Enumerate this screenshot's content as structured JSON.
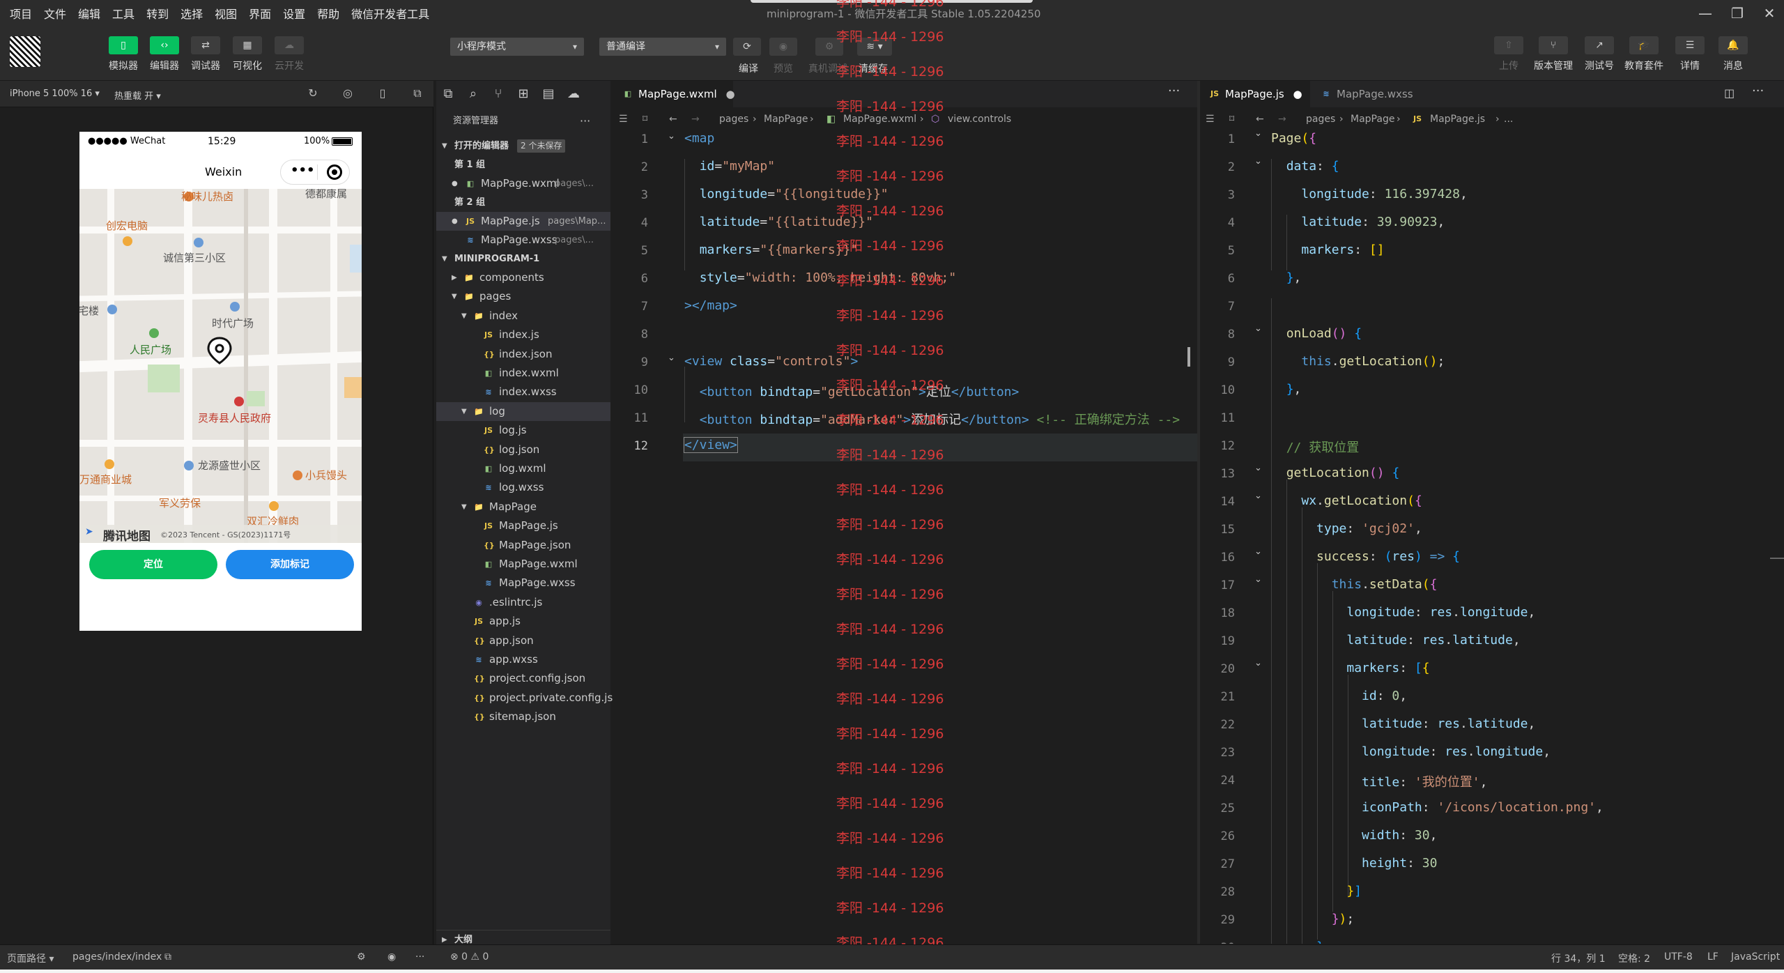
{
  "menu": [
    "项目",
    "文件",
    "编辑",
    "工具",
    "转到",
    "选择",
    "视图",
    "界面",
    "设置",
    "帮助",
    "微信开发者工具"
  ],
  "window_title": "miniprogram-1 - 微信开发者工具 Stable 1.05.2204250",
  "toolbar": {
    "left_buttons": [
      {
        "label": "模拟器",
        "icon": "phone-icon",
        "on": true
      },
      {
        "label": "编辑器",
        "icon": "code-icon",
        "on": true
      },
      {
        "label": "调试器",
        "icon": "debug-icon",
        "on": false
      },
      {
        "label": "可视化",
        "icon": "layout-icon",
        "on": false
      },
      {
        "label": "云开发",
        "icon": "cloud-icon",
        "on": false
      }
    ],
    "mode_select": "小程序模式",
    "compile_select": "普通编译",
    "mid_labels": [
      "编译",
      "预览",
      "真机调试",
      "清缓存"
    ],
    "right_buttons": [
      {
        "label": "上传",
        "icon": "upload-icon"
      },
      {
        "label": "版本管理",
        "icon": "branch-icon"
      },
      {
        "label": "测试号",
        "icon": "external-icon"
      },
      {
        "label": "教育套件",
        "icon": "graduation-icon"
      },
      {
        "label": "详情",
        "icon": "list-icon"
      },
      {
        "label": "消息",
        "icon": "bell-icon"
      }
    ]
  },
  "simulator": {
    "device": "iPhone 5 100% 16 ▾",
    "hot_reload": "热重载 开 ▾",
    "status_left": "●●●●● WeChat",
    "status_time": "15:29",
    "status_right": "100%",
    "nav_title": "Weixin",
    "map_pois": [
      "秘味儿热卤",
      "德都康属",
      "创宏电脑",
      "诚信第三小区",
      "时代广场",
      "宅楼",
      "人民广场",
      "灵寿县人民政府",
      "万通商业城",
      "龙源盛世小区",
      "小兵馒头",
      "军义劳保",
      "双汇冷鲜肉",
      "腾讯地图",
      "©2023 Tencent - GS(2023)1171号"
    ],
    "button_locate": "定位",
    "button_add_marker": "添加标记"
  },
  "explorer": {
    "title": "资源管理器",
    "open_editors": "打开的编辑器",
    "unsaved_badge": "2 个未保存",
    "group1": "第 1 组",
    "group1_file": "MapPage.wxml",
    "group1_file_path": "pages\\...",
    "group2": "第 2 组",
    "group2_file1": "MapPage.js",
    "group2_file1_path": "pages\\Map...",
    "group2_file2": "MapPage.wxss",
    "group2_file2_path": "pages\\...",
    "project": "MINIPROGRAM-1",
    "tree": [
      {
        "name": "components",
        "type": "folder",
        "depth": 1,
        "open": false
      },
      {
        "name": "pages",
        "type": "folder",
        "depth": 1,
        "open": true
      },
      {
        "name": "index",
        "type": "folder",
        "depth": 2,
        "open": true
      },
      {
        "name": "index.js",
        "type": "js",
        "depth": 3
      },
      {
        "name": "index.json",
        "type": "json",
        "depth": 3
      },
      {
        "name": "index.wxml",
        "type": "wxml",
        "depth": 3
      },
      {
        "name": "index.wxss",
        "type": "wxss",
        "depth": 3
      },
      {
        "name": "log",
        "type": "folder",
        "depth": 2,
        "open": true,
        "selected": true
      },
      {
        "name": "log.js",
        "type": "js",
        "depth": 3
      },
      {
        "name": "log.json",
        "type": "json",
        "depth": 3
      },
      {
        "name": "log.wxml",
        "type": "wxml",
        "depth": 3
      },
      {
        "name": "log.wxss",
        "type": "wxss",
        "depth": 3
      },
      {
        "name": "MapPage",
        "type": "folder",
        "depth": 2,
        "open": true
      },
      {
        "name": "MapPage.js",
        "type": "js",
        "depth": 3
      },
      {
        "name": "MapPage.json",
        "type": "json",
        "depth": 3
      },
      {
        "name": "MapPage.wxml",
        "type": "wxml",
        "depth": 3
      },
      {
        "name": "MapPage.wxss",
        "type": "wxss",
        "depth": 3
      },
      {
        "name": ".eslintrc.js",
        "type": "eslint",
        "depth": 2
      },
      {
        "name": "app.js",
        "type": "js",
        "depth": 2
      },
      {
        "name": "app.json",
        "type": "json",
        "depth": 2
      },
      {
        "name": "app.wxss",
        "type": "wxss",
        "depth": 2
      },
      {
        "name": "project.config.json",
        "type": "json",
        "depth": 2
      },
      {
        "name": "project.private.config.js...",
        "type": "json",
        "depth": 2
      },
      {
        "name": "sitemap.json",
        "type": "json",
        "depth": 2
      }
    ],
    "outline": "大纲"
  },
  "editor_left": {
    "tab": "MapPage.wxml",
    "crumbs": [
      "pages",
      "MapPage",
      "MapPage.wxml",
      "view.controls"
    ],
    "current_line": 12
  },
  "editor_right": {
    "tab_active": "MapPage.js",
    "tab_other": "MapPage.wxss",
    "crumbs": [
      "pages",
      "MapPage",
      "MapPage.js",
      "..."
    ]
  },
  "watermark": "李阳 -144 - 1296",
  "statusbar": {
    "path_label": "页面路径 ▾",
    "path": "pages/index/index",
    "problems": "⊗ 0 ⚠ 0",
    "cursor": "行 34，列 1",
    "spaces": "空格: 2",
    "encoding": "UTF-8",
    "eol": "LF",
    "language": "JavaScript"
  }
}
